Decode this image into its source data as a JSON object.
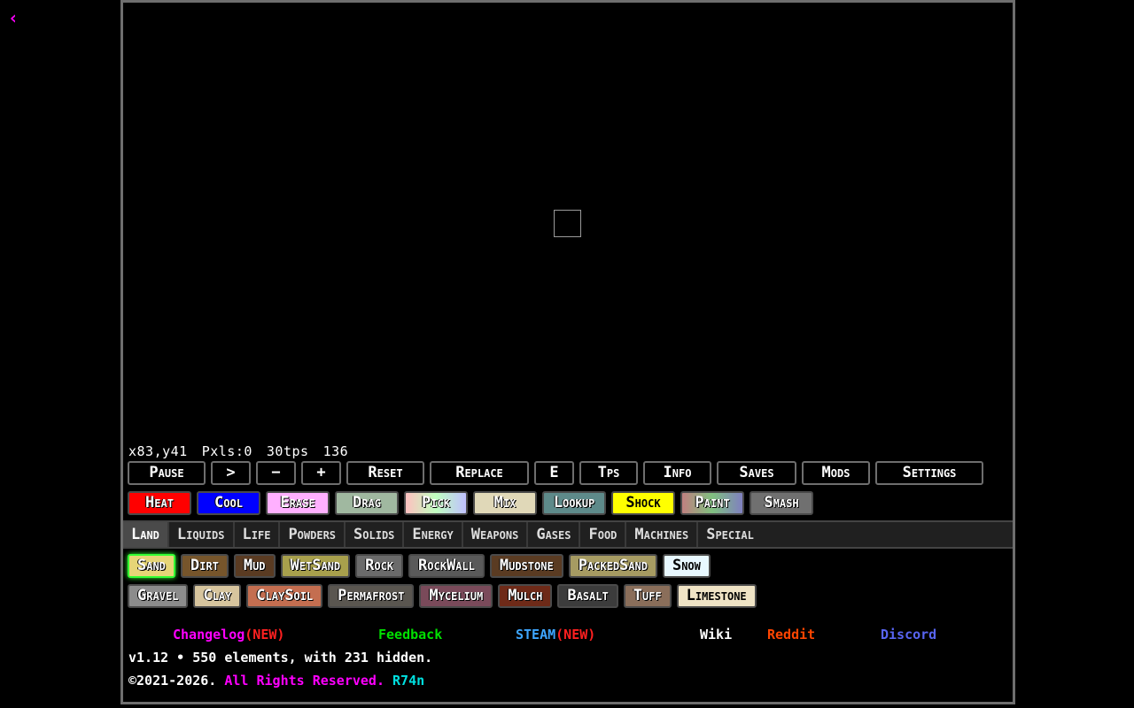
{
  "back_icon": "chevron-left-icon",
  "stats": {
    "coords": "x83,y41",
    "pixels": "Pxls:0",
    "tps": "30tps",
    "fps": "136"
  },
  "controls": [
    {
      "label": "Pause",
      "w": 88
    },
    {
      "label": ">",
      "w": 45
    },
    {
      "label": "−",
      "w": 45
    },
    {
      "label": "+",
      "w": 45
    },
    {
      "label": "Reset",
      "w": 88
    },
    {
      "label": "Replace",
      "w": 112
    },
    {
      "label": "E",
      "w": 45
    },
    {
      "label": "Tps",
      "w": 66
    },
    {
      "label": "Info",
      "w": 77
    },
    {
      "label": "Saves",
      "w": 90
    },
    {
      "label": "Mods",
      "w": 77
    },
    {
      "label": "Settings",
      "w": 122
    }
  ],
  "tools": [
    {
      "label": "Heat",
      "color": "#ff0000"
    },
    {
      "label": "Cool",
      "color": "#0000ff"
    },
    {
      "label": "Erase",
      "color": "#ffb0ff"
    },
    {
      "label": "Drag",
      "color": "#a0b8a0"
    },
    {
      "label": "Pick",
      "color": "#ffd0c0"
    },
    {
      "label": "Mix",
      "color": "#e0d8b8"
    },
    {
      "label": "Lookup",
      "color": "#5e8a8a"
    },
    {
      "label": "Shock",
      "color": "#ffff00"
    },
    {
      "label": "Paint",
      "color": "#b48c8c"
    },
    {
      "label": "Smash",
      "color": "#707070"
    }
  ],
  "tabs": [
    "Land",
    "Liquids",
    "Life",
    "Powders",
    "Solids",
    "Energy",
    "Weapons",
    "Gases",
    "Food",
    "Machines",
    "Special"
  ],
  "active_tab": "Land",
  "elements_row1": [
    {
      "label": "Sand",
      "color": "#e6d577",
      "selected": true
    },
    {
      "label": "Dirt",
      "color": "#76552b"
    },
    {
      "label": "Mud",
      "color": "#5a3b22"
    },
    {
      "label": "WetSand",
      "color": "#a8a04c"
    },
    {
      "label": "Rock",
      "color": "#6b6b6b"
    },
    {
      "label": "RockWall",
      "color": "#5a5a5a"
    },
    {
      "label": "Mudstone",
      "color": "#5a3b22"
    },
    {
      "label": "PackedSand",
      "color": "#a69b62"
    },
    {
      "label": "Snow",
      "color": "#e8f8ff"
    }
  ],
  "elements_row2": [
    {
      "label": "Gravel",
      "color": "#8c8c8c"
    },
    {
      "label": "Clay",
      "color": "#d7c59e"
    },
    {
      "label": "ClaySoil",
      "color": "#c46e50"
    },
    {
      "label": "Permafrost",
      "color": "#5a5650"
    },
    {
      "label": "Mycelium",
      "color": "#7a4a5a"
    },
    {
      "label": "Mulch",
      "color": "#6e2a18"
    },
    {
      "label": "Basalt",
      "color": "#3c3c3c"
    },
    {
      "label": "Tuff",
      "color": "#8a6e5a"
    },
    {
      "label": "Limestone",
      "color": "#efe3c5"
    }
  ],
  "links": [
    {
      "label": "Changelog",
      "suffix": "(NEW)",
      "color": "#ff00ff",
      "suffix_color": "#ff2020"
    },
    {
      "label": "Feedback",
      "suffix": "",
      "color": "#00e000"
    },
    {
      "label": "STEAM",
      "suffix": "(NEW)",
      "color": "#3ea6ff",
      "suffix_color": "#ff2020"
    },
    {
      "label": "Wiki",
      "suffix": "",
      "color": "#ffffff"
    },
    {
      "label": "Reddit",
      "suffix": "",
      "color": "#ff4500"
    },
    {
      "label": "Discord",
      "suffix": "",
      "color": "#5865f2"
    }
  ],
  "version_line": "v1.12 • 550 elements, with 231 hidden.",
  "copyright": "©2021-2026.",
  "rights": "All Rights Reserved.",
  "author": "R74n"
}
